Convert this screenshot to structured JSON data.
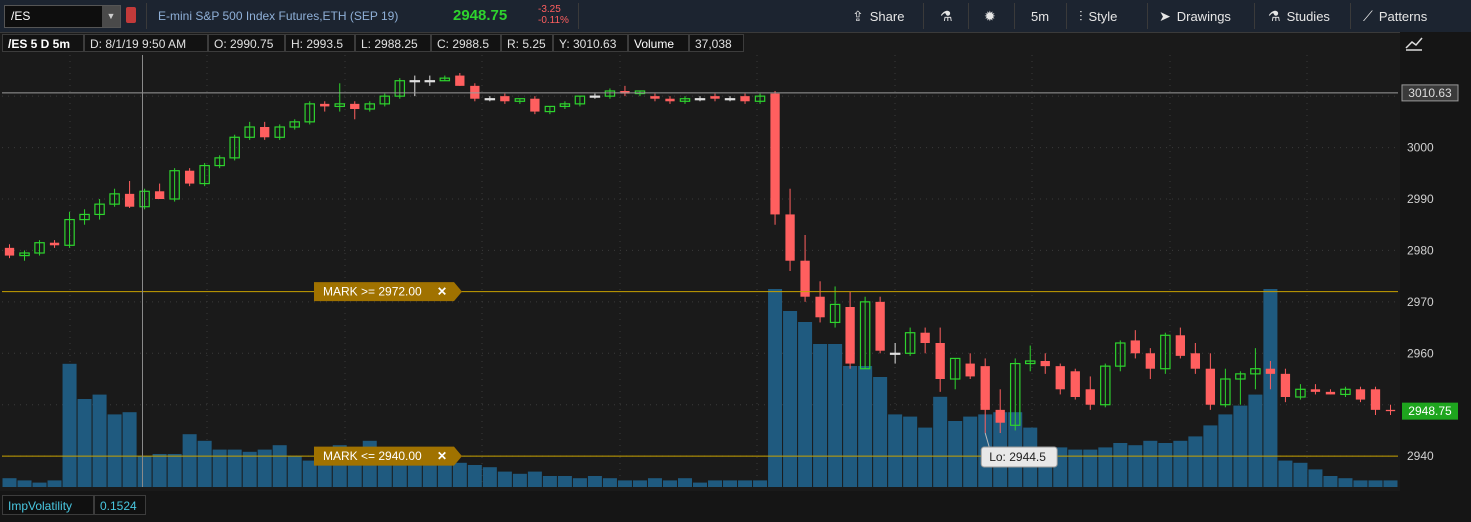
{
  "toolbar": {
    "symbol": "/ES",
    "description": "E-mini S&P 500 Index Futures,ETH (SEP 19)",
    "last_price": "2948.75",
    "net_change": "-3.25",
    "pct_change": "-0.11%",
    "share_label": "Share",
    "timeframe_label": "5m",
    "style_label": "Style",
    "drawings_label": "Drawings",
    "studies_label": "Studies",
    "patterns_label": "Patterns"
  },
  "info": {
    "symbol_label": "/ES 5 D 5m",
    "date": "D: 8/1/19 9:50 AM",
    "open": "O: 2990.75",
    "high": "H: 2993.5",
    "low": "L: 2988.25",
    "close": "C: 2988.5",
    "range": "R: 5.25",
    "y": "Y: 3010.63",
    "volume_label": "Volume",
    "volume_value": "37,038"
  },
  "alerts": [
    {
      "label": "MARK >= 2972.00",
      "price": 2972
    },
    {
      "label": "MARK <= 2940.00",
      "price": 2940
    }
  ],
  "close_icon_glyph": "✕",
  "price_badges": {
    "ref_line": "3010.63",
    "current": "2948.75",
    "low_callout": "Lo: 2944.5"
  },
  "study": {
    "name": "ImpVolatility",
    "value": "0.1524"
  },
  "colors": {
    "up": "#2ed32e",
    "down": "#ff5f5f",
    "volume": "#1f5a7f",
    "alert": "#c8a200",
    "background": "#1a1a1a"
  },
  "chart_data": {
    "type": "candlestick",
    "ylim": [
      2934,
      3018
    ],
    "yticks": [
      2940,
      2950,
      2960,
      2970,
      2980,
      2990,
      3000,
      3010
    ],
    "ytick_labels": [
      "2940",
      "",
      "2960",
      "2970",
      "2980",
      "2990",
      "3000",
      ""
    ],
    "reference_line": 3010.63,
    "candles": [
      [
        2980.5,
        2981.2,
        2978.5,
        2979.0
      ],
      [
        2979.0,
        2980.0,
        2978.0,
        2979.5
      ],
      [
        2979.5,
        2982.0,
        2979.0,
        2981.5
      ],
      [
        2981.5,
        2982.0,
        2980.5,
        2981.0
      ],
      [
        2981.0,
        2987.5,
        2980.5,
        2986.0
      ],
      [
        2986.0,
        2988.0,
        2985.0,
        2987.0
      ],
      [
        2987.0,
        2990.0,
        2986.0,
        2989.0
      ],
      [
        2989.0,
        2992.0,
        2988.5,
        2991.0
      ],
      [
        2991.0,
        2993.5,
        2988.25,
        2988.5
      ],
      [
        2988.5,
        2992.0,
        2988.0,
        2991.5
      ],
      [
        2991.5,
        2993.0,
        2990.0,
        2990.0
      ],
      [
        2990.0,
        2996.0,
        2989.5,
        2995.5
      ],
      [
        2995.5,
        2996.0,
        2992.5,
        2993.0
      ],
      [
        2993.0,
        2997.0,
        2992.5,
        2996.5
      ],
      [
        2996.5,
        2998.5,
        2996.0,
        2998.0
      ],
      [
        2998.0,
        3002.5,
        2997.5,
        3002.0
      ],
      [
        3002.0,
        3005.0,
        3001.5,
        3004.0
      ],
      [
        3004.0,
        3005.0,
        3001.5,
        3002.0
      ],
      [
        3002.0,
        3004.5,
        3001.5,
        3004.0
      ],
      [
        3004.0,
        3005.5,
        3003.5,
        3005.0
      ],
      [
        3005.0,
        3009.0,
        3004.5,
        3008.5
      ],
      [
        3008.5,
        3009.0,
        3007.0,
        3008.0
      ],
      [
        3008.0,
        3012.5,
        3007.0,
        3008.5
      ],
      [
        3008.5,
        3009.0,
        3005.5,
        3007.5
      ],
      [
        3007.5,
        3009.0,
        3007.0,
        3008.5
      ],
      [
        3008.5,
        3010.5,
        3008.0,
        3010.0
      ],
      [
        3010.0,
        3013.5,
        3009.5,
        3013.0
      ],
      [
        3013.0,
        3014.0,
        3010.0,
        3013.0
      ],
      [
        3013.0,
        3014.0,
        3012.0,
        3013.0
      ],
      [
        3013.0,
        3014.0,
        3013.0,
        3013.5
      ],
      [
        3014.0,
        3014.5,
        3012.0,
        3012.0
      ],
      [
        3012.0,
        3012.5,
        3009.0,
        3009.5
      ],
      [
        3009.5,
        3010.0,
        3009.0,
        3009.5
      ],
      [
        3010.0,
        3010.5,
        3008.5,
        3009.0
      ],
      [
        3009.0,
        3009.5,
        3008.5,
        3009.5
      ],
      [
        3009.5,
        3010.0,
        3006.5,
        3007.0
      ],
      [
        3007.0,
        3008.0,
        3006.5,
        3008.0
      ],
      [
        3008.0,
        3009.0,
        3007.5,
        3008.5
      ],
      [
        3008.5,
        3010.0,
        3008.0,
        3010.0
      ],
      [
        3010.0,
        3010.5,
        3009.5,
        3010.0
      ],
      [
        3010.0,
        3011.5,
        3009.5,
        3011.0
      ],
      [
        3011.0,
        3012.0,
        3010.0,
        3010.5
      ],
      [
        3010.5,
        3011.0,
        3010.0,
        3011.0
      ],
      [
        3010.0,
        3010.5,
        3009.0,
        3009.5
      ],
      [
        3009.5,
        3010.0,
        3008.5,
        3009.0
      ],
      [
        3009.0,
        3010.0,
        3008.5,
        3009.5
      ],
      [
        3009.5,
        3010.0,
        3009.0,
        3009.5
      ],
      [
        3010.0,
        3010.5,
        3009.0,
        3009.5
      ],
      [
        3009.5,
        3010.0,
        3009.0,
        3009.5
      ],
      [
        3010.0,
        3010.5,
        3008.5,
        3009.0
      ],
      [
        3009.0,
        3010.5,
        3008.5,
        3010.0
      ],
      [
        3010.5,
        3011.0,
        2985.0,
        2987.0
      ],
      [
        2987.0,
        2992.0,
        2976.0,
        2978.0
      ],
      [
        2978.0,
        2983.0,
        2970.0,
        2971.0
      ],
      [
        2971.0,
        2974.0,
        2966.0,
        2967.0
      ],
      [
        2966.0,
        2973.0,
        2965.0,
        2969.5
      ],
      [
        2969.0,
        2972.0,
        2957.0,
        2958.0
      ],
      [
        2957.0,
        2971.0,
        2957.0,
        2970.0
      ],
      [
        2970.0,
        2971.0,
        2960.0,
        2960.5
      ],
      [
        2960.0,
        2962.0,
        2958.0,
        2960.0
      ],
      [
        2960.0,
        2965.0,
        2959.5,
        2964.0
      ],
      [
        2964.0,
        2965.0,
        2960.0,
        2962.0
      ],
      [
        2962.0,
        2965.0,
        2952.5,
        2955.0
      ],
      [
        2955.0,
        2959.0,
        2953.0,
        2959.0
      ],
      [
        2958.0,
        2960.0,
        2955.0,
        2955.5
      ],
      [
        2957.5,
        2959.0,
        2944.5,
        2949.0
      ],
      [
        2949.0,
        2953.0,
        2944.5,
        2946.5
      ],
      [
        2946.0,
        2959.0,
        2945.0,
        2958.0
      ],
      [
        2958.0,
        2961.5,
        2956.5,
        2958.5
      ],
      [
        2958.5,
        2960.0,
        2956.0,
        2957.5
      ],
      [
        2957.5,
        2958.0,
        2952.0,
        2953.0
      ],
      [
        2956.5,
        2957.0,
        2951.0,
        2951.5
      ],
      [
        2953.0,
        2955.5,
        2949.0,
        2950.0
      ],
      [
        2950.0,
        2958.0,
        2949.5,
        2957.5
      ],
      [
        2957.5,
        2962.5,
        2956.5,
        2962.0
      ],
      [
        2962.5,
        2964.5,
        2959.0,
        2960.0
      ],
      [
        2960.0,
        2961.0,
        2955.0,
        2957.0
      ],
      [
        2957.0,
        2964.0,
        2956.0,
        2963.5
      ],
      [
        2963.5,
        2965.0,
        2959.0,
        2959.5
      ],
      [
        2960.0,
        2962.0,
        2956.0,
        2957.0
      ],
      [
        2957.0,
        2960.0,
        2949.0,
        2950.0
      ],
      [
        2950.0,
        2957.0,
        2949.5,
        2955.0
      ],
      [
        2955.0,
        2956.5,
        2950.0,
        2956.0
      ],
      [
        2956.0,
        2961.0,
        2953.0,
        2957.0
      ],
      [
        2957.0,
        2958.5,
        2953.0,
        2956.0
      ],
      [
        2956.0,
        2957.0,
        2950.5,
        2951.5
      ],
      [
        2951.5,
        2954.0,
        2951.0,
        2953.0
      ],
      [
        2953.0,
        2954.0,
        2952.0,
        2952.5
      ],
      [
        2952.5,
        2953.0,
        2952.0,
        2952.0
      ],
      [
        2952.0,
        2953.5,
        2951.5,
        2953.0
      ],
      [
        2953.0,
        2953.5,
        2950.5,
        2951.0
      ],
      [
        2953.0,
        2953.5,
        2948.0,
        2949.0
      ],
      [
        2949.0,
        2950.0,
        2948.0,
        2948.75
      ]
    ],
    "volume": [
      0.04,
      0.03,
      0.02,
      0.03,
      0.56,
      0.4,
      0.42,
      0.33,
      0.34,
      0.14,
      0.15,
      0.15,
      0.24,
      0.21,
      0.17,
      0.17,
      0.16,
      0.17,
      0.19,
      0.14,
      0.12,
      0.18,
      0.19,
      0.18,
      0.21,
      0.14,
      0.11,
      0.11,
      0.11,
      0.12,
      0.11,
      0.1,
      0.09,
      0.07,
      0.06,
      0.07,
      0.05,
      0.05,
      0.04,
      0.05,
      0.04,
      0.03,
      0.03,
      0.04,
      0.03,
      0.04,
      0.02,
      0.03,
      0.03,
      0.03,
      0.03,
      0.9,
      0.8,
      0.75,
      0.65,
      0.65,
      0.55,
      0.55,
      0.5,
      0.33,
      0.32,
      0.27,
      0.41,
      0.3,
      0.32,
      0.33,
      0.34,
      0.34,
      0.27,
      0.17,
      0.18,
      0.17,
      0.17,
      0.18,
      0.2,
      0.19,
      0.21,
      0.2,
      0.21,
      0.23,
      0.28,
      0.33,
      0.37,
      0.42,
      0.9,
      0.12,
      0.11,
      0.08,
      0.05,
      0.04,
      0.03,
      0.03,
      0.03
    ]
  }
}
